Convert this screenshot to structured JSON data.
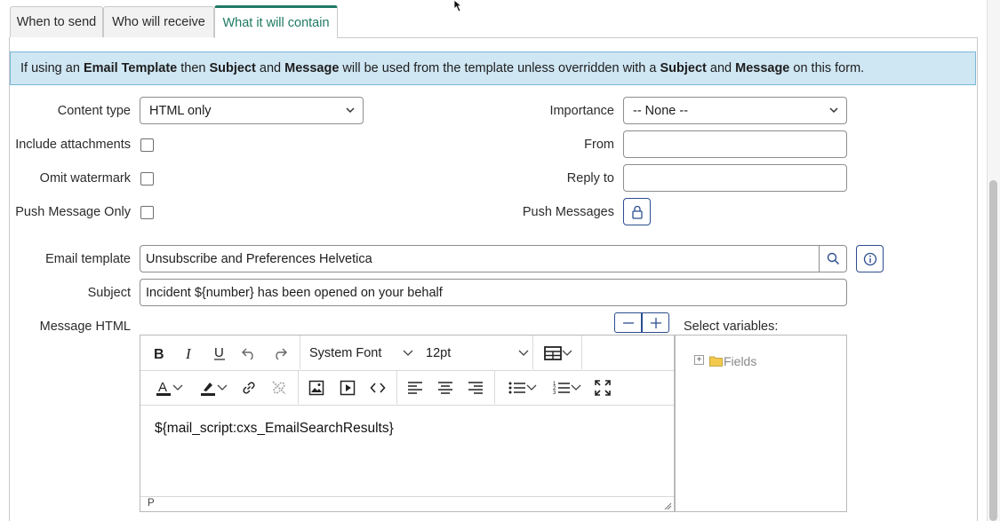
{
  "tabs": [
    {
      "label": "When to send"
    },
    {
      "label": "Who will receive"
    },
    {
      "label": "What it will contain",
      "active": true
    }
  ],
  "banner": {
    "p1": "If using an ",
    "b1": "Email Template",
    "p2": " then ",
    "b2": "Subject",
    "p3": " and ",
    "b3": "Message",
    "p4": " will be used from the template unless overridden with a ",
    "b4": "Subject",
    "p5": " and ",
    "b5": "Message",
    "p6": " on this form."
  },
  "form": {
    "content_type_label": "Content type",
    "content_type_value": "HTML only",
    "include_attachments_label": "Include attachments",
    "omit_watermark_label": "Omit watermark",
    "push_message_only_label": "Push Message Only",
    "importance_label": "Importance",
    "importance_value": "-- None --",
    "from_label": "From",
    "from_value": "",
    "reply_to_label": "Reply to",
    "reply_to_value": "",
    "push_messages_label": "Push Messages",
    "email_template_label": "Email template",
    "email_template_value": "Unsubscribe and Preferences Helvetica",
    "subject_label": "Subject",
    "subject_value": "Incident ${number} has been opened on your behalf",
    "message_html_label": "Message HTML",
    "select_variables_label": "Select variables:"
  },
  "editor": {
    "font_family": "System Font",
    "font_size": "12pt",
    "content": "${mail_script:cxs_EmailSearchResults}",
    "status_path": "P"
  },
  "variables_tree": [
    {
      "label": "Fields",
      "expander": "+"
    }
  ],
  "colors": {
    "accent": "#1f7a63",
    "banner_bg": "#cfe6f3",
    "banner_border": "#79b7d6",
    "button_border": "#2b4d8f"
  }
}
